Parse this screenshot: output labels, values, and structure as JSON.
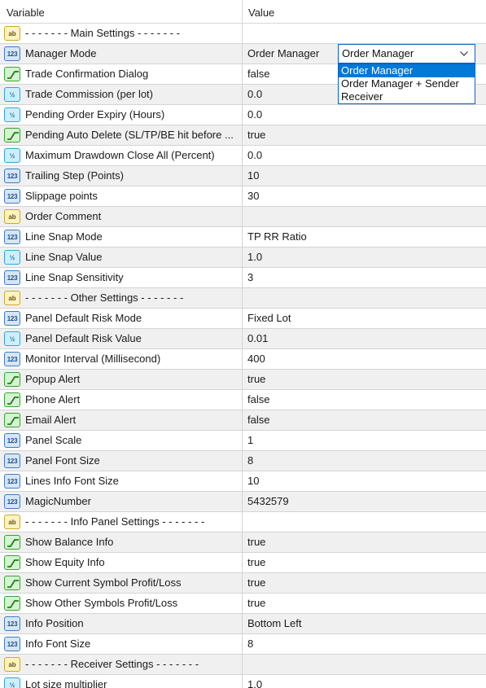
{
  "header": {
    "variable": "Variable",
    "value": "Value"
  },
  "rows": [
    {
      "type": "string",
      "icon_text": "ab",
      "label": "- - - - - - - Main Settings - - - - - - -",
      "value": ""
    },
    {
      "type": "int",
      "icon_text": "123",
      "label": "Manager Mode",
      "value": "Order Manager"
    },
    {
      "type": "bool",
      "icon_text": "",
      "label": "Trade Confirmation Dialog",
      "value": "false"
    },
    {
      "type": "double",
      "icon_text": "½",
      "label": "Trade Commission (per lot)",
      "value": "0.0"
    },
    {
      "type": "double",
      "icon_text": "½",
      "label": "Pending Order Expiry (Hours)",
      "value": "0.0"
    },
    {
      "type": "bool",
      "icon_text": "",
      "label": "Pending Auto Delete (SL/TP/BE hit before ...",
      "value": "true"
    },
    {
      "type": "double",
      "icon_text": "½",
      "label": "Maximum Drawdown Close All (Percent)",
      "value": "0.0"
    },
    {
      "type": "int",
      "icon_text": "123",
      "label": "Trailing Step (Points)",
      "value": "10"
    },
    {
      "type": "int",
      "icon_text": "123",
      "label": "Slippage points",
      "value": "30"
    },
    {
      "type": "string",
      "icon_text": "ab",
      "label": "Order Comment",
      "value": ""
    },
    {
      "type": "int",
      "icon_text": "123",
      "label": "Line Snap Mode",
      "value": "TP RR Ratio"
    },
    {
      "type": "double",
      "icon_text": "½",
      "label": "Line Snap Value",
      "value": "1.0"
    },
    {
      "type": "int",
      "icon_text": "123",
      "label": "Line Snap Sensitivity",
      "value": "3"
    },
    {
      "type": "string",
      "icon_text": "ab",
      "label": "- - - - - - - Other Settings - - - - - - -",
      "value": ""
    },
    {
      "type": "int",
      "icon_text": "123",
      "label": "Panel Default Risk Mode",
      "value": "Fixed Lot"
    },
    {
      "type": "double",
      "icon_text": "½",
      "label": "Panel Default Risk Value",
      "value": "0.01"
    },
    {
      "type": "int",
      "icon_text": "123",
      "label": "Monitor Interval (Millisecond)",
      "value": "400"
    },
    {
      "type": "bool",
      "icon_text": "",
      "label": "Popup Alert",
      "value": "true"
    },
    {
      "type": "bool",
      "icon_text": "",
      "label": "Phone Alert",
      "value": "false"
    },
    {
      "type": "bool",
      "icon_text": "",
      "label": "Email Alert",
      "value": "false"
    },
    {
      "type": "int",
      "icon_text": "123",
      "label": "Panel Scale",
      "value": "1"
    },
    {
      "type": "int",
      "icon_text": "123",
      "label": "Panel Font Size",
      "value": "8"
    },
    {
      "type": "int",
      "icon_text": "123",
      "label": "Lines Info Font Size",
      "value": "10"
    },
    {
      "type": "int",
      "icon_text": "123",
      "label": "MagicNumber",
      "value": "5432579"
    },
    {
      "type": "string",
      "icon_text": "ab",
      "label": "- - - - - - - Info Panel Settings - - - - - - -",
      "value": ""
    },
    {
      "type": "bool",
      "icon_text": "",
      "label": "Show Balance Info",
      "value": "true"
    },
    {
      "type": "bool",
      "icon_text": "",
      "label": "Show Equity Info",
      "value": "true"
    },
    {
      "type": "bool",
      "icon_text": "",
      "label": "Show Current Symbol Profit/Loss",
      "value": "true"
    },
    {
      "type": "bool",
      "icon_text": "",
      "label": "Show Other Symbols Profit/Loss",
      "value": "true"
    },
    {
      "type": "int",
      "icon_text": "123",
      "label": "Info Position",
      "value": "Bottom Left"
    },
    {
      "type": "int",
      "icon_text": "123",
      "label": "Info Font Size",
      "value": "8"
    },
    {
      "type": "string",
      "icon_text": "ab",
      "label": "- - - - - - - Receiver Settings - - - - - - -",
      "value": ""
    },
    {
      "type": "double",
      "icon_text": "½",
      "label": "Lot size multiplier",
      "value": "1.0"
    }
  ],
  "manager_mode_select": {
    "selected": "Order Manager",
    "options": [
      "Order Manager",
      "Order Manager + Sender",
      "Receiver"
    ],
    "highlighted_index": 0
  },
  "colors": {
    "selection": "#0078d7",
    "focus_border": "#0a60c8",
    "alt_row": "#f0f0f0",
    "grid_line": "#d4d4d4"
  }
}
